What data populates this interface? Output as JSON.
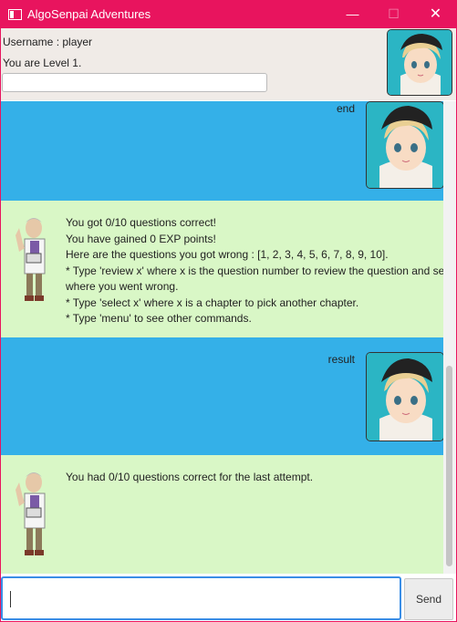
{
  "window": {
    "title": "AlgoSenpai Adventures",
    "minimize": "—",
    "maximize": "☐",
    "close": "✕"
  },
  "header": {
    "username": "Username : player",
    "level": "You are Level 1.",
    "exp_progress": 0
  },
  "dialogs": [
    {
      "type": "user",
      "text": "end"
    },
    {
      "type": "bot",
      "text": "You got 0/10 questions correct!\nYou have gained 0 EXP points!\nHere are the questions you got wrong : [1, 2, 3, 4, 5, 6, 7, 8, 9, 10].\n* Type 'review x' where x is the question number to review the question and see\nwhere you went wrong.\n* Type 'select x' where x is a chapter to pick another chapter.\n* Type 'menu' to see other commands."
    },
    {
      "type": "user",
      "text": "result"
    },
    {
      "type": "bot",
      "text": "You had 0/10 questions correct for the last attempt."
    }
  ],
  "input": {
    "value": ""
  },
  "send": {
    "label": "Send"
  },
  "colors": {
    "titlebar": "#e8145e",
    "user_bubble": "#34b0e8",
    "bot_bubble": "#d9f7c6"
  }
}
